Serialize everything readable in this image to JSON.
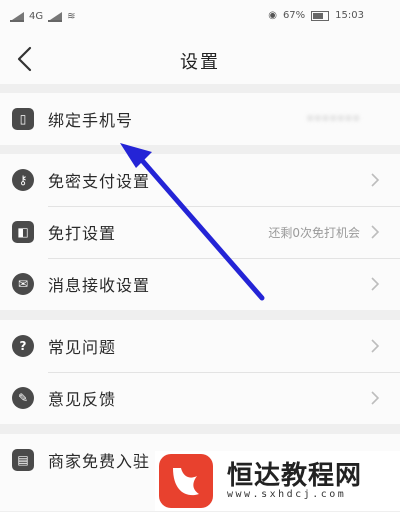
{
  "status_bar": {
    "network": "4G",
    "battery": "67%",
    "time": "15:03"
  },
  "header": {
    "title": "设置"
  },
  "groups": [
    {
      "items": [
        {
          "label": "绑定手机号",
          "value": ""
        }
      ]
    },
    {
      "items": [
        {
          "label": "免密支付设置",
          "value": ""
        },
        {
          "label": "免打设置",
          "value": "还剩0次免打机会"
        },
        {
          "label": "消息接收设置",
          "value": ""
        }
      ]
    },
    {
      "items": [
        {
          "label": "常见问题",
          "value": ""
        },
        {
          "label": "意见反馈",
          "value": ""
        }
      ]
    },
    {
      "items": [
        {
          "label": "商家免费入驻",
          "value": ""
        }
      ]
    }
  ],
  "watermark": {
    "name": "恒达教程网",
    "url": "www.sxhdcj.com"
  },
  "colors": {
    "arrow": "#2424d6",
    "background": "#efefef",
    "watermark_logo": "#e8412e"
  }
}
